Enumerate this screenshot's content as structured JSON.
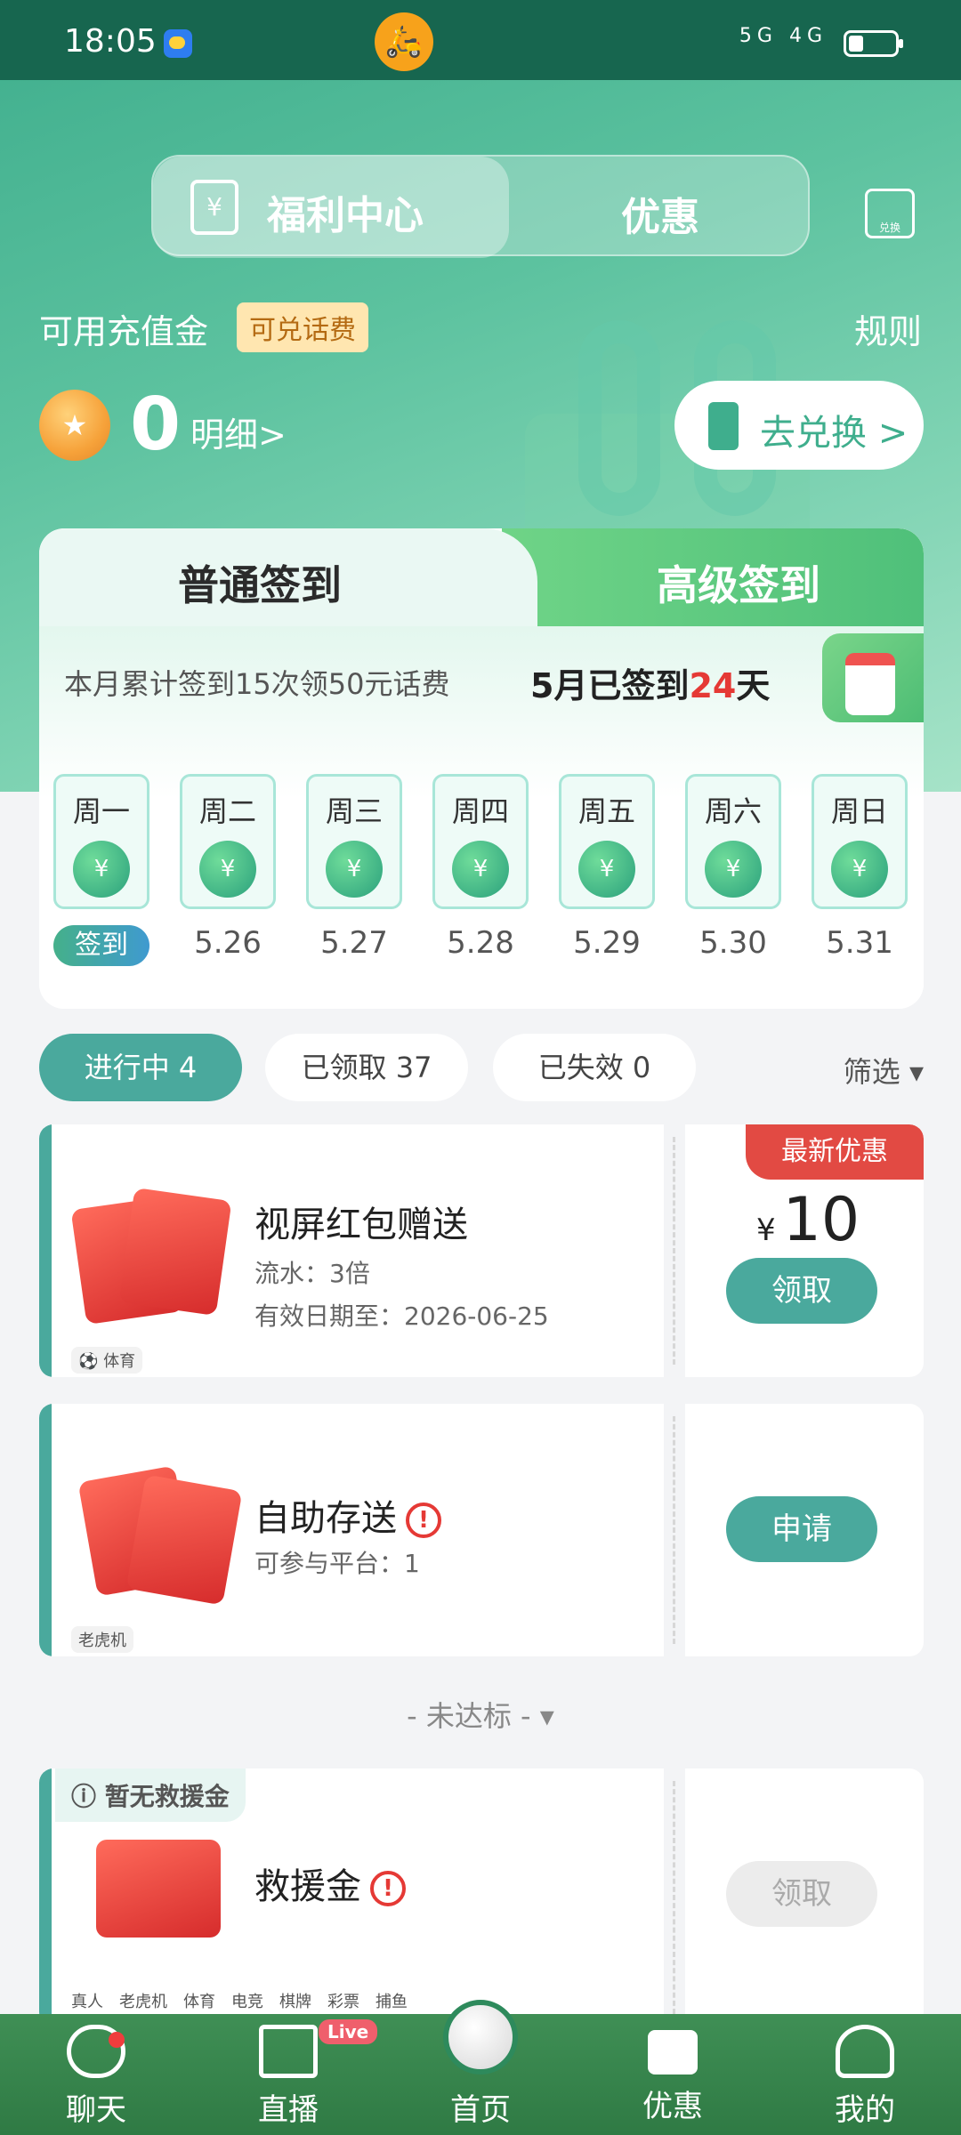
{
  "status_bar": {
    "time": "18:05",
    "signal": "5G 4G",
    "colors": {
      "bar": "#17664f"
    }
  },
  "header": {
    "tab_active": "福利中心",
    "tab_other": "优惠",
    "exchange_icon_label": "兑换",
    "wallet_label": "可用充值金",
    "wallet_badge": "可兑话费",
    "rules": "规则",
    "balance": "0",
    "detail_link": "明细>",
    "go_exchange": "去兑换 >"
  },
  "checkin": {
    "tab_normal": "普通签到",
    "tab_premium": "高级签到",
    "note": "本月累计签到15次领50元话费",
    "status_prefix": "5月已签到",
    "status_days": "24",
    "status_suffix": "天",
    "days": [
      {
        "week": "周一",
        "date": "签到",
        "is_button": true
      },
      {
        "week": "周二",
        "date": "5.26"
      },
      {
        "week": "周三",
        "date": "5.27"
      },
      {
        "week": "周四",
        "date": "5.28"
      },
      {
        "week": "周五",
        "date": "5.29"
      },
      {
        "week": "周六",
        "date": "5.30"
      },
      {
        "week": "周日",
        "date": "5.31"
      }
    ]
  },
  "filter": {
    "in_progress": "进行中 4",
    "claimed": "已领取 37",
    "expired": "已失效 0",
    "screen": "筛选"
  },
  "coupons": [
    {
      "title": "视屏红包赠送",
      "line1": "流水：3倍",
      "line2": "有效日期至：2026-06-25",
      "tag": "⚽ 体育",
      "badge": "最新优惠",
      "currency": "¥",
      "amount": "10",
      "button": "领取"
    },
    {
      "title": "自助存送",
      "line1": "可参与平台：1",
      "tag": "老虎机",
      "button": "申请"
    }
  ],
  "divider": "- 未达标 -",
  "rescue": {
    "badge": "暂无救援金",
    "title": "救援金",
    "button": "领取",
    "platforms": [
      "真人",
      "老虎机",
      "体育",
      "电竞",
      "棋牌",
      "彩票",
      "捕鱼"
    ]
  },
  "bottom_nav": {
    "chat": "聊天",
    "live": "直播",
    "live_badge": "Live",
    "home": "首页",
    "promo": "优惠",
    "mine": "我的"
  },
  "colors": {
    "accent": "#4aa99d",
    "hero": "#3fae8d",
    "nav": "#2f7a44",
    "red": "#e53935"
  }
}
